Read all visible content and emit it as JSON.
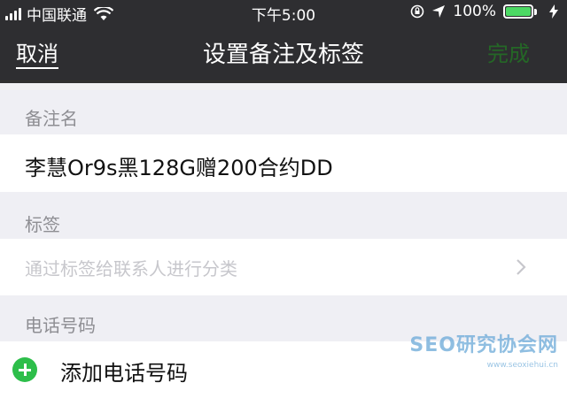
{
  "status_bar": {
    "carrier": "中国联通",
    "time": "下午5:00",
    "battery_percent": "100%",
    "battery_level": 1.0,
    "icons": [
      "signal-icon",
      "wifi-icon",
      "rotation-lock-icon",
      "location-icon",
      "battery-icon",
      "charging-icon"
    ]
  },
  "nav": {
    "cancel_label": "取消",
    "title": "设置备注及标签",
    "done_label": "完成"
  },
  "remark": {
    "section_label": "备注名",
    "value": "李慧Or9s黑128G赠200合约DD"
  },
  "tags": {
    "section_label": "标签",
    "placeholder": "通过标签给联系人进行分类"
  },
  "phone": {
    "section_label": "电话号码",
    "add_label": "添加电话号码"
  },
  "watermark": {
    "text": "SEO研究协会网",
    "url": "www.seoxiehui.cn"
  },
  "colors": {
    "nav_background": "#2e2e31",
    "accent_green": "#1aad19",
    "page_background": "#efeff4"
  }
}
